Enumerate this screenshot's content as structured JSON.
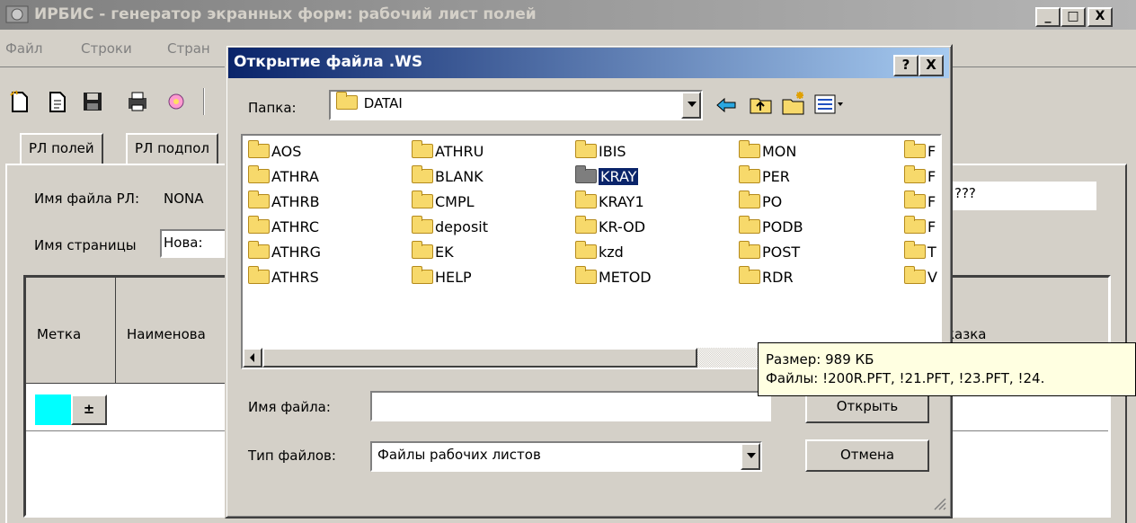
{
  "main_window": {
    "title": "ИРБИС - генератор экранных форм: рабочий лист полей",
    "controls": {
      "minimize": "_",
      "maximize": "□",
      "close": "X"
    }
  },
  "menu": [
    "Файл",
    "Строки",
    "Стран"
  ],
  "toolbar_icons": [
    "new-icon",
    "open-icon",
    "save-icon",
    "print-icon",
    "settings-icon"
  ],
  "tabs": [
    {
      "label": "РЛ полей"
    },
    {
      "label": "РЛ подпол"
    }
  ],
  "form": {
    "worklist_file_label": "Имя файла РЛ:",
    "worklist_file_value": "NONA",
    "worklist_file_value_tail": "???",
    "page_name_label": "Имя страницы",
    "page_name_value": "Нова:"
  },
  "grid": {
    "columns": [
      "Метка",
      "Наименова",
      "казка"
    ],
    "row_color": "#00ffff",
    "row_button": "±"
  },
  "dialog": {
    "title": "Открытие файла .WS",
    "help_button": "?",
    "close_button": "X",
    "folder_label": "Папка:",
    "folder_value": "DATAI",
    "toolbar": [
      "back-arrow-icon",
      "up-folder-icon",
      "new-folder-icon",
      "view-menu-icon"
    ],
    "folders": [
      [
        "AOS",
        "ATHRA",
        "ATHRB",
        "ATHRC",
        "ATHRG",
        "ATHRS"
      ],
      [
        "ATHRU",
        "BLANK",
        "CMPL",
        "deposit",
        "EK",
        "HELP"
      ],
      [
        "IBIS",
        "KRAY",
        "KRAY1",
        "KR-OD",
        "kzd",
        "METOD"
      ],
      [
        "MON",
        "PER",
        "PO",
        "PODB",
        "POST",
        "RDR"
      ],
      [
        "F",
        "F",
        "F",
        "F",
        "T",
        "V"
      ]
    ],
    "selected_folder": "KRAY",
    "filename_label": "Имя файла:",
    "filename_value": "",
    "filetype_label": "Тип файлов:",
    "filetype_value": "Файлы рабочих листов",
    "open_button": "Открыть",
    "cancel_button": "Отмена"
  },
  "tooltip": {
    "size": "Размер: 989 КБ",
    "files": "Файлы: !200R.PFT, !21.PFT, !23.PFT, !24."
  }
}
